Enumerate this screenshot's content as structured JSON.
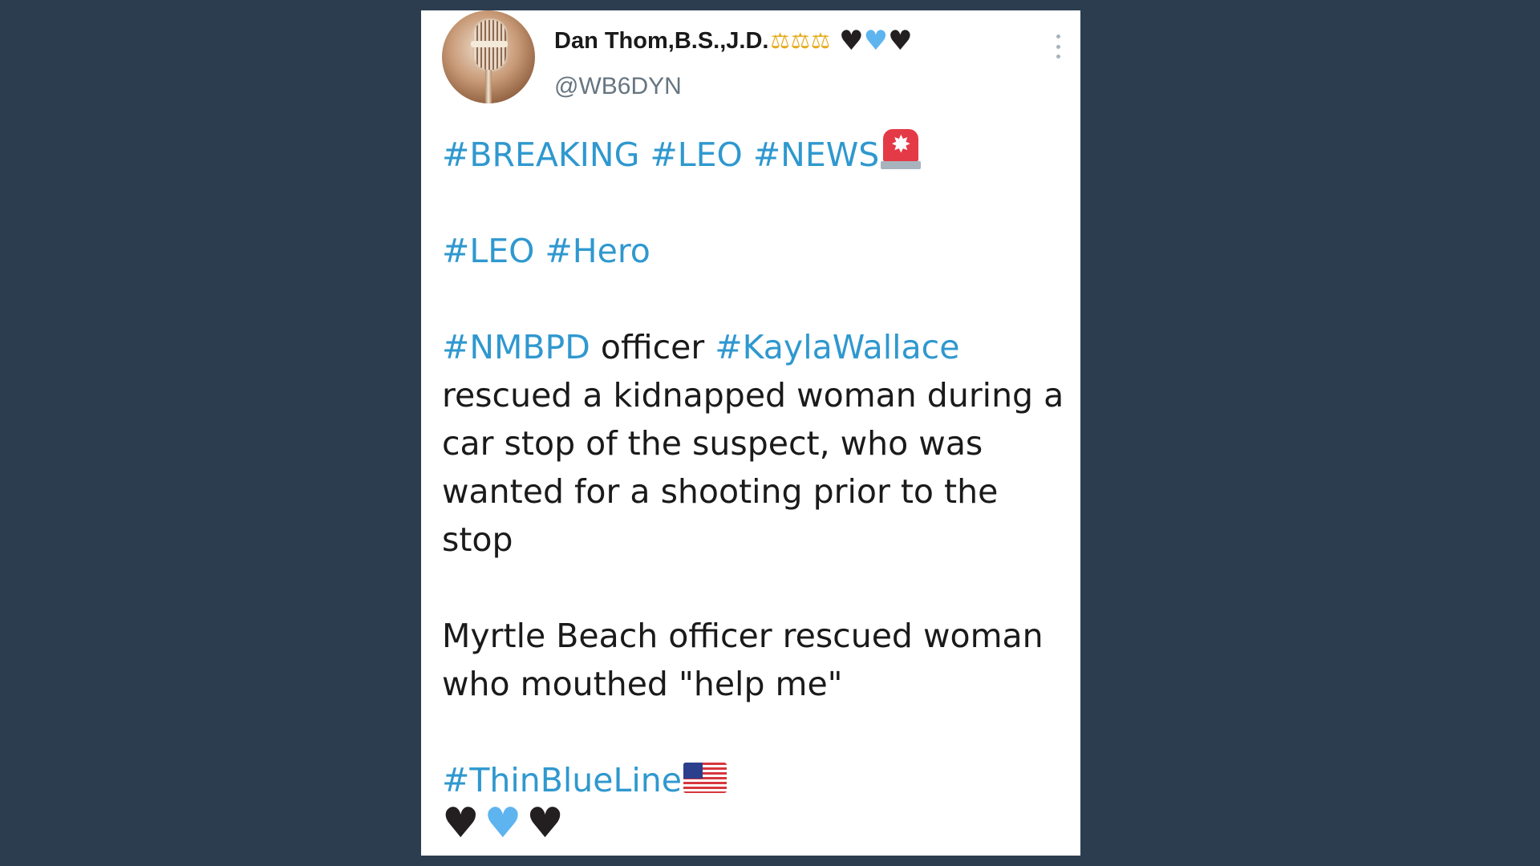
{
  "tweet": {
    "display_name": "Dan Thom,B.S.,J.D.",
    "name_emoji": "⚖⚖⚖",
    "name_hearts": [
      "black-heart",
      "blue-heart",
      "black-heart"
    ],
    "handle": "@WB6DYN",
    "avatar": "microphone-avatar",
    "menu_icon": "more-vertical-icon",
    "line1": {
      "tags": [
        "#BREAKING",
        "#LEO",
        "#NEWS"
      ],
      "emoji": "police-siren"
    },
    "line2": {
      "tags": [
        "#LEO",
        "#Hero"
      ]
    },
    "para3": {
      "tag1": "#NMBPD",
      "word": "officer",
      "tag2": "#KaylaWallace",
      "text": "rescued a kidnapped woman during a car stop of the suspect, who was wanted for a shooting prior to the stop"
    },
    "para4": {
      "text": "Myrtle Beach officer rescued woman who mouthed \"help me\""
    },
    "para5": {
      "tag": "#ThinBlueLine",
      "emoji": "us-flag",
      "hearts": [
        "black-heart",
        "blue-heart",
        "black-heart"
      ]
    }
  },
  "colors": {
    "background": "#2c3d50",
    "card": "#ffffff",
    "hashtag": "#2f98cf",
    "text": "#1a1a1a",
    "handle": "#667580",
    "scales": "#e6a817",
    "heart_black": "#231f20",
    "heart_blue": "#5eb4ef"
  }
}
